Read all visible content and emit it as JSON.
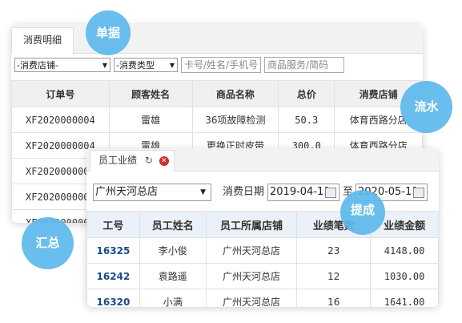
{
  "back_panel": {
    "tab": "消费明细",
    "filters": {
      "store_select": "-消费店铺-",
      "type_select": "-消费类型",
      "card_placeholder": "卡号/姓名/手机号",
      "goods_placeholder": "商品服务/简码"
    },
    "columns": [
      "订单号",
      "顾客姓名",
      "商品名称",
      "总价",
      "消费店铺"
    ],
    "rows": [
      [
        "XF2020000004",
        "雷雄",
        "36项故障检测",
        "50.3",
        "体育西路分店"
      ],
      [
        "XF2020000004",
        "雷雄",
        "更换正时皮带",
        "300.0",
        "体育西路分店"
      ],
      [
        "XF2020000004",
        "",
        "",
        "",
        ""
      ],
      [
        "XF2020000004",
        "",
        "",
        "",
        ""
      ],
      [
        "XF2020000004",
        "",
        "",
        "",
        ""
      ]
    ]
  },
  "front_panel": {
    "tab": "员工业绩",
    "store_select": "广州天河总店",
    "date_label": "消费日期",
    "date_from": "2019-04-11",
    "to_label": "至",
    "date_to": "2020-05-11",
    "columns": [
      "工号",
      "员工姓名",
      "员工所属店铺",
      "业绩笔数",
      "业绩金额"
    ],
    "rows": [
      [
        "16325",
        "李小俊",
        "广州天河总店",
        "23",
        "4148.00"
      ],
      [
        "16242",
        "袁路遥",
        "广州天河总店",
        "12",
        "1030.00"
      ],
      [
        "16320",
        "小满",
        "广州天河总店",
        "16",
        "1641.00"
      ]
    ]
  },
  "badges": {
    "danju": "单据",
    "liushui": "流水",
    "huizong": "汇总",
    "ticheng": "提成"
  },
  "colors": {
    "badge": "#5cb8eb",
    "link": "#1b4a8c",
    "close": "#d32b2b",
    "header_front": "#eaf1f8"
  }
}
